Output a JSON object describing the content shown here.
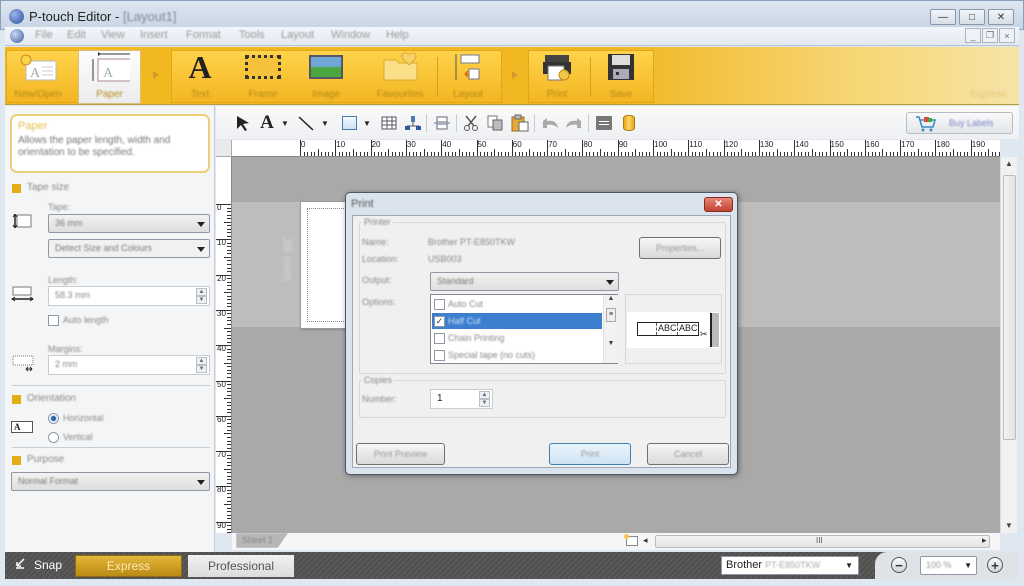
{
  "window": {
    "title": "P-touch Editor -",
    "doc_name": "[Layout1]",
    "controls": {
      "minimize": "—",
      "maximize": "□",
      "close": "✕"
    },
    "mdi_controls": {
      "minimize": "_",
      "restore": "❐",
      "close": "×"
    }
  },
  "menu": [
    "File",
    "Edit",
    "View",
    "Insert",
    "Format",
    "Tools",
    "Layout",
    "Window",
    "Help"
  ],
  "ribbon": {
    "buttons": [
      {
        "id": "new-open",
        "label": "New/Open",
        "icon": "new-document-icon"
      },
      {
        "id": "paper",
        "label": "Paper",
        "icon": "paper-icon",
        "active": true
      },
      {
        "id": "text",
        "label": "Text",
        "icon": "text-icon"
      },
      {
        "id": "frame",
        "label": "Frame",
        "icon": "frame-icon"
      },
      {
        "id": "image",
        "label": "Image",
        "icon": "image-icon"
      },
      {
        "id": "favourites",
        "label": "Favourites",
        "icon": "favourites-icon"
      },
      {
        "id": "layout",
        "label": "Layout",
        "icon": "layout-icon"
      },
      {
        "id": "print",
        "label": "Print",
        "icon": "printer-icon"
      },
      {
        "id": "save",
        "label": "Save",
        "icon": "save-icon"
      }
    ],
    "mode_label": "Express",
    "accent_color": "#f3b81f"
  },
  "left_panel": {
    "help_title": "Paper",
    "help_desc": "Allows the paper length, width and orientation to be specified.",
    "tape_size": {
      "section": "Tape size",
      "tape_label": "Tape:",
      "tape_value": "36 mm",
      "detect_value": "Detect Size and Colours",
      "length_label": "Length:",
      "length_value": "58.3 mm",
      "auto_length_label": "Auto length",
      "auto_length_checked": false,
      "margins_label": "Margins:",
      "margins_value": "2 mm"
    },
    "orientation": {
      "section": "Orientation",
      "options": [
        "Horizontal",
        "Vertical"
      ],
      "selected": "Horizontal"
    },
    "purpose": {
      "section": "Purpose",
      "value": "Normal Format"
    }
  },
  "toolbar": {
    "tools": [
      "select-arrow",
      "text-tool",
      "line-tool",
      "rectangle-tool",
      "table-tool",
      "org-chart-tool",
      "align-tool",
      "cut",
      "copy",
      "paste",
      "undo",
      "redo",
      "properties",
      "database"
    ],
    "buy_labels": "Buy Labels"
  },
  "rulers": {
    "horizontal_ticks": [
      "0",
      "10",
      "20",
      "30",
      "40",
      "50",
      "60",
      "70",
      "80",
      "90",
      "100",
      "110",
      "120",
      "130",
      "140",
      "150",
      "160",
      "170",
      "180",
      "190"
    ],
    "vertical_ticks": [
      "0",
      "10",
      "20",
      "30",
      "40",
      "50",
      "60",
      "70",
      "80",
      "90"
    ]
  },
  "canvas": {
    "tape_width_text": "36 mm",
    "sheet_tab": "Sheet 1"
  },
  "print_dialog": {
    "title": "Print",
    "printer_group": "Printer",
    "name_label": "Name:",
    "name_value": "Brother PT-E850TKW",
    "location_label": "Location:",
    "location_value": "USB003",
    "properties_button": "Properties...",
    "output_label": "Output:",
    "output_value": "Standard",
    "options_label": "Options:",
    "options": [
      {
        "label": "Auto Cut",
        "checked": false,
        "selected": false
      },
      {
        "label": "Half Cut",
        "checked": true,
        "selected": true
      },
      {
        "label": "Chain Printing",
        "checked": false,
        "selected": false
      },
      {
        "label": "Special tape (no cuts)",
        "checked": false,
        "selected": false
      }
    ],
    "preview_text": [
      "ABC",
      "ABC"
    ],
    "copies_group": "Copies",
    "number_label": "Number:",
    "number_value": "1",
    "print_preview_button": "Print Preview",
    "print_button": "Print",
    "cancel_button": "Cancel"
  },
  "bottom_bar": {
    "snap_label": "Snap",
    "express_label": "Express",
    "professional_label": "Professional",
    "printer_brand": "Brother",
    "printer_model": "PT-E850TKW",
    "zoom_value": "100 %"
  }
}
